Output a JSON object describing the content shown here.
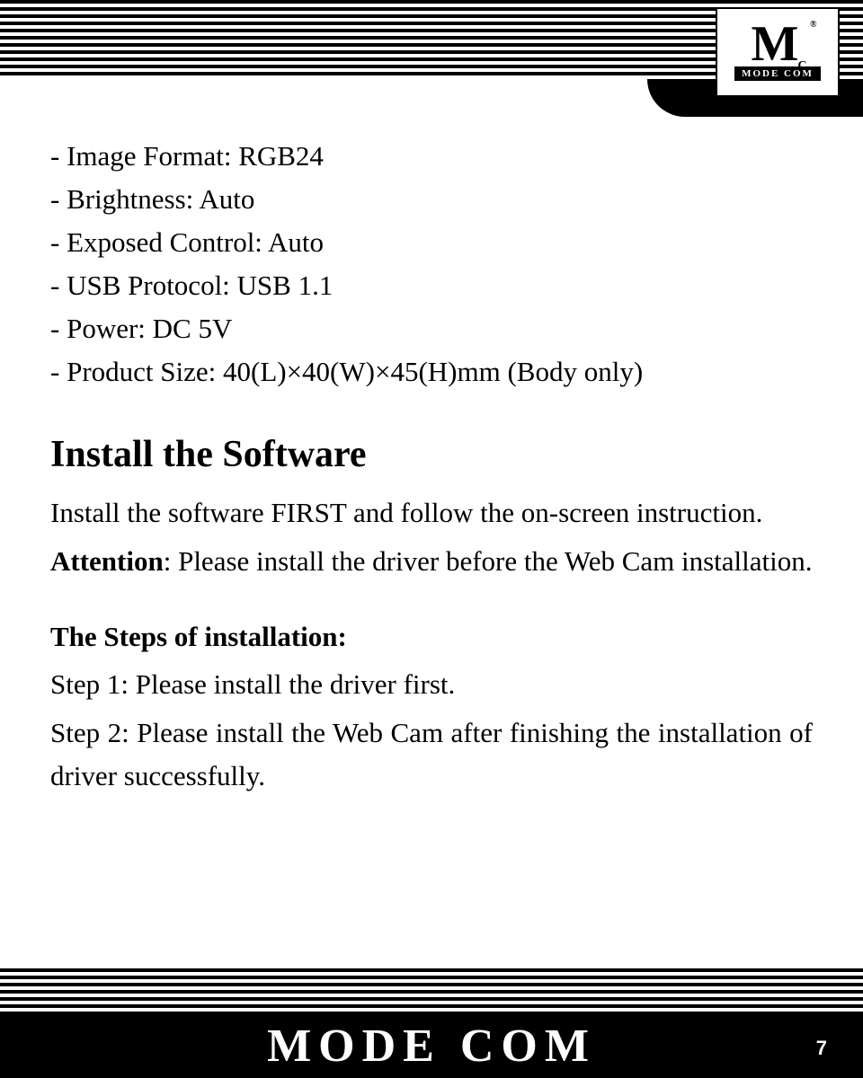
{
  "logo": {
    "mark": "M",
    "sub_letter": "C",
    "registered": "®",
    "brand_small": "MODE COM"
  },
  "specs": [
    "- Image Format: RGB24",
    "- Brightness: Auto",
    "- Exposed Control: Auto",
    "- USB Protocol: USB 1.1",
    "- Power: DC 5V",
    "- Product Size: 40(L)×40(W)×45(H)mm (Body only)"
  ],
  "install": {
    "heading": "Install the Software",
    "intro": "Install the software FIRST and follow the on-screen instruction.",
    "attention_label": "Attention",
    "attention_text": ": Please install the driver before the Web Cam installation.",
    "steps_heading": "The Steps of installation:",
    "step1": "Step 1: Please install the driver first.",
    "step2": "Step 2: Please install the Web Cam after finishing the installation of driver successfully."
  },
  "footer": {
    "brand": "MODE COM",
    "page": "7"
  }
}
